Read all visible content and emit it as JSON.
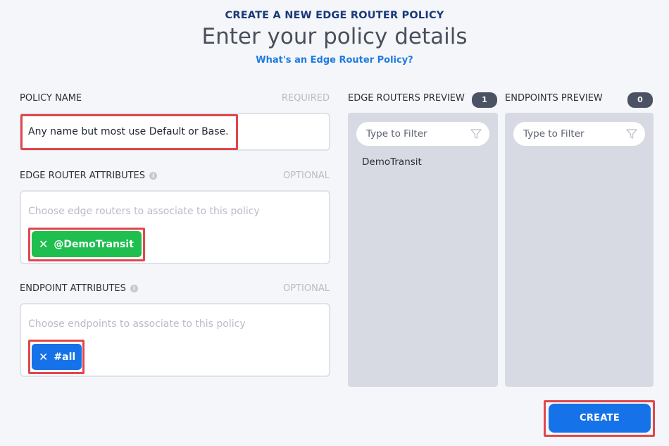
{
  "header": {
    "kicker": "CREATE A NEW EDGE ROUTER POLICY",
    "title": "Enter your policy details",
    "help_link": "What's an Edge Router Policy?"
  },
  "policy_name": {
    "label": "POLICY NAME",
    "hint": "REQUIRED",
    "value": "Any name but most use Default or Base."
  },
  "edge_router_attributes": {
    "label": "EDGE ROUTER ATTRIBUTES",
    "hint": "OPTIONAL",
    "placeholder": "Choose edge routers to associate to this policy",
    "chips": [
      {
        "label": "@DemoTransit",
        "color": "#1fbf4f"
      }
    ]
  },
  "endpoint_attributes": {
    "label": "ENDPOINT ATTRIBUTES",
    "hint": "OPTIONAL",
    "placeholder": "Choose endpoints to associate to this policy",
    "chips": [
      {
        "label": "#all",
        "color": "#1572e8"
      }
    ]
  },
  "edge_routers_preview": {
    "label": "EDGE ROUTERS PREVIEW",
    "count": "1",
    "filter_placeholder": "Type to Filter",
    "items": [
      "DemoTransit"
    ]
  },
  "endpoints_preview": {
    "label": "ENDPOINTS PREVIEW",
    "count": "0",
    "filter_placeholder": "Type to Filter",
    "items": []
  },
  "actions": {
    "create_label": "CREATE"
  },
  "colors": {
    "accent": "#1572e8",
    "highlight": "#e0474c",
    "chip_green": "#1fbf4f",
    "title_navy": "#1a3a7a"
  }
}
